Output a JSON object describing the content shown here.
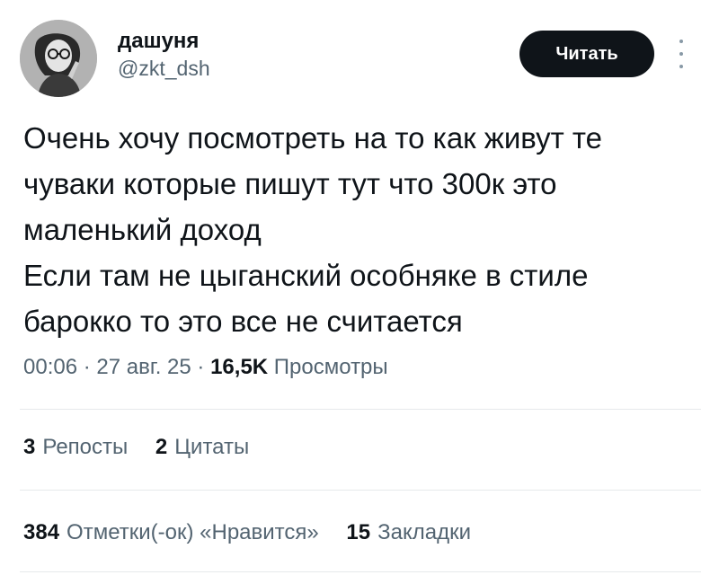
{
  "author": {
    "display_name": "дашуня",
    "handle": "@zkt_dsh",
    "avatar_icon": "profile-photo"
  },
  "actions": {
    "follow_label": "Читать",
    "more_icon": "vertical-dots-icon"
  },
  "tweet": {
    "text": "Очень хочу посмотреть на то как живут те\nчуваки которые пишут тут что 300к это\nмаленький доход\nЕсли там не цыганский особняке в стиле\nбарокко то это все не считается"
  },
  "meta": {
    "time": "00:06",
    "separator": "·",
    "date": "27 авг. 25",
    "views_count": "16,5K",
    "views_label": "Просмотры"
  },
  "stats": {
    "reposts_count": "3",
    "reposts_label": "Репосты",
    "quotes_count": "2",
    "quotes_label": "Цитаты",
    "likes_count": "384",
    "likes_label": "Отметки(-ок) «Нравится»",
    "bookmarks_count": "15",
    "bookmarks_label": "Закладки"
  },
  "colors": {
    "text_primary": "#0f1419",
    "text_secondary": "#536471",
    "button_bg": "#0f1419",
    "button_text": "#ffffff",
    "divider": "#e6e9eb"
  }
}
